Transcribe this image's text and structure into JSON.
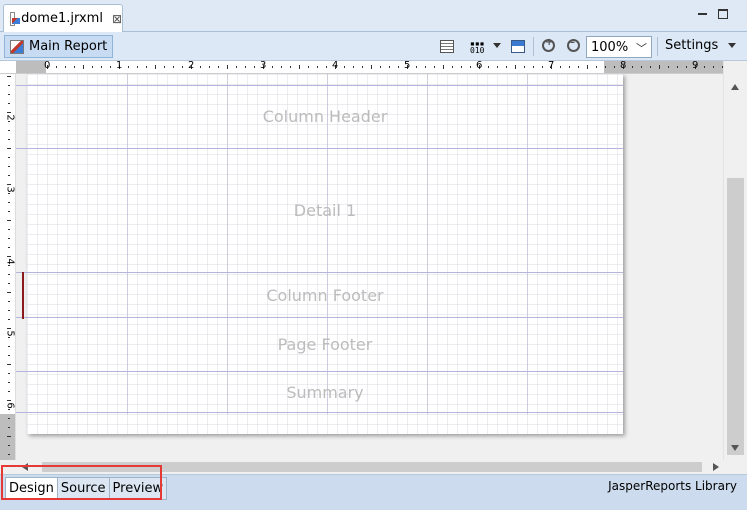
{
  "editor_tab": {
    "title": "dome1.jrxml",
    "close_glyph": "⊠"
  },
  "toolbar": {
    "main_report_label": "Main Report",
    "zoom_value": "100%",
    "settings_label": "Settings"
  },
  "ruler": {
    "horizontal_labels": [
      "0",
      "1",
      "2",
      "3",
      "4",
      "5",
      "6",
      "7",
      "8",
      "9"
    ],
    "vertical_labels": [
      "2",
      "3",
      "4",
      "5",
      "6"
    ]
  },
  "bands": [
    {
      "label": "Column Header"
    },
    {
      "label": "Detail 1"
    },
    {
      "label": "Column Footer"
    },
    {
      "label": "Page Footer"
    },
    {
      "label": "Summary"
    }
  ],
  "bottom_tabs": [
    {
      "label": "Design",
      "selected": true
    },
    {
      "label": "Source",
      "selected": false
    },
    {
      "label": "Preview",
      "selected": false
    }
  ],
  "status": {
    "library_label": "JasperReports Library"
  },
  "colors": {
    "highlight": "#e53935",
    "band_line": "#b4b4dc",
    "toolbar_bg": "#dce8f5"
  }
}
